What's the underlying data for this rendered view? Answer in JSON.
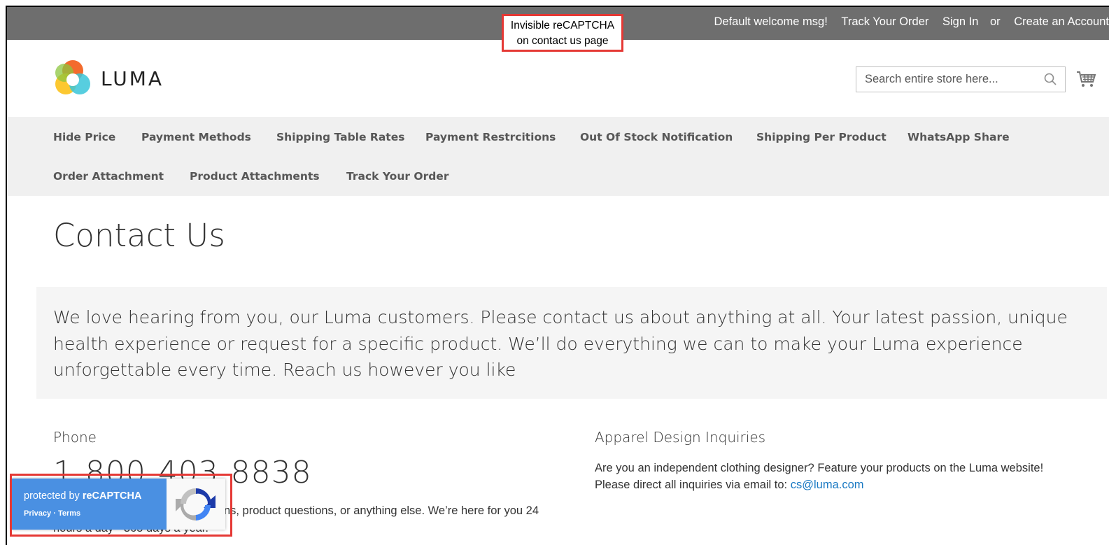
{
  "top_bar": {
    "welcome": "Default welcome msg!",
    "track_order": "Track Your Order",
    "sign_in": "Sign In",
    "or": "or",
    "create_account": "Create an Account"
  },
  "callout": {
    "line1": "Invisible reCAPTCHA",
    "line2": "on contact us page"
  },
  "header": {
    "logo_text": "LUMA",
    "search_placeholder": "Search entire store here...",
    "icons": {
      "search": "search-icon",
      "cart": "cart-icon"
    }
  },
  "nav": {
    "row1": [
      "Hide Price",
      "Payment Methods",
      "Shipping Table Rates",
      "Payment Restrcitions",
      "Out Of Stock Notification",
      "Shipping Per Product",
      "WhatsApp Share"
    ],
    "row2": [
      "Order Attachment",
      "Product Attachments",
      "Track Your Order"
    ]
  },
  "page": {
    "title": "Contact Us",
    "intro": "We love hearing from you, our Luma customers. Please contact us about anything at all. Your latest passion, unique health experience or request for a specific product. We’ll do everything we can to make your Luma experience unforgettable every time. Reach us however you like"
  },
  "phone": {
    "label": "Phone",
    "number": "1-800-403-8838",
    "desc": "Call the Luma Helpline for concerns, product questions, or anything else. We’re here for you 24 hours a day - 365 days a year."
  },
  "apparel": {
    "label": "Apparel Design Inquiries",
    "desc_line1": "Are you an independent clothing designer? Feature your products on the Luma website!",
    "desc_line2_prefix": "Please direct all inquiries via email to:",
    "email": "cs@luma.com"
  },
  "recaptcha": {
    "protected_prefix": "protected by",
    "protected_brand": "reCAPTCHA",
    "privacy": "Privacy",
    "separator": "·",
    "terms": "Terms"
  },
  "colors": {
    "top_bar": "#6e6e6e",
    "nav_bg": "#f0f0f0",
    "link": "#1979c3",
    "badge_blue": "#4a90e2",
    "callout_border": "#e53935"
  }
}
